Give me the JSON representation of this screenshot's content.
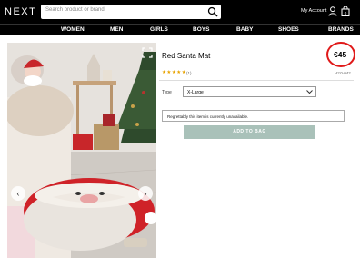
{
  "header": {
    "logo": "NEXT",
    "search_placeholder": "Search product or brand",
    "account_label": "My Account",
    "icons": {
      "search": "search-icon",
      "user": "user-icon",
      "bag": "bag-icon"
    }
  },
  "nav": {
    "items": [
      {
        "label": "WOMEN"
      },
      {
        "label": "MEN"
      },
      {
        "label": "GIRLS"
      },
      {
        "label": "BOYS"
      },
      {
        "label": "BABY"
      },
      {
        "label": "SHOES"
      },
      {
        "label": "BRANDS"
      }
    ]
  },
  "product": {
    "title": "Red Santa Mat",
    "price": "€45",
    "rating_stars": "★★★★★",
    "reviews": "(1)",
    "code": "410-042",
    "type_label": "Type",
    "type_value": "X-Large",
    "unavailable_notice": "Regrettably this item is currently unavailable.",
    "add_to_bag_label": "ADD TO BAG",
    "colors": {
      "accent_circle": "#e01a1a",
      "add_button": "#a9c1b9"
    }
  },
  "gallery": {
    "prev_icon": "chevron-left-icon",
    "next_icon": "chevron-right-icon",
    "zoom_icon": "zoom-icon"
  }
}
